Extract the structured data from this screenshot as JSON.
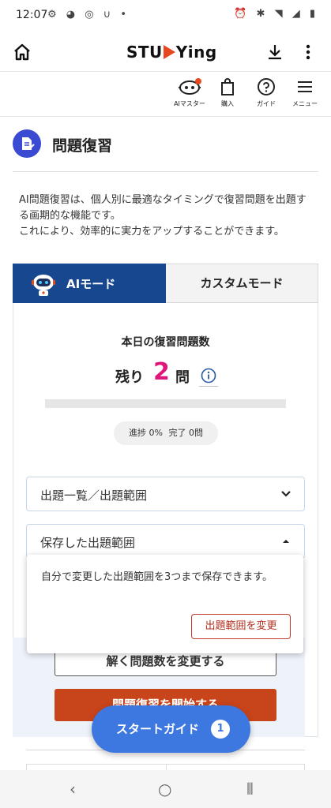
{
  "status_bar": {
    "time": "12:07",
    "left_icons": [
      "settings-icon",
      "photo-icon",
      "chrome-icon",
      "magnet-icon",
      "dot-icon"
    ],
    "right_icons": [
      "alarm-icon",
      "bluetooth-icon",
      "wifi-icon",
      "signal-icon",
      "battery-icon"
    ]
  },
  "header": {
    "logo_left": "STU",
    "logo_right": "Ying"
  },
  "toolbar": {
    "items": [
      {
        "label": "AIマスター",
        "icon": "robot-icon",
        "has_badge": true
      },
      {
        "label": "購入",
        "icon": "shopping-bag-icon"
      },
      {
        "label": "ガイド",
        "icon": "help-circle-icon"
      },
      {
        "label": "メニュー",
        "icon": "hamburger-icon"
      }
    ]
  },
  "page": {
    "title": "問題復習",
    "description": "AI問題復習は、個人別に最適なタイミングで復習問題を出題する画期的な機能です。\nこれにより、効率的に実力をアップすることができます。"
  },
  "tabs": {
    "ai": "AIモード",
    "custom": "カスタムモード",
    "active": "ai"
  },
  "review": {
    "today_label": "本日の復習問題数",
    "remaining_prefix": "残り",
    "remaining_count": "2",
    "remaining_suffix": "問",
    "progress_percent": 0,
    "progress_label": "進捗 0%",
    "completed_label": "完了 0問"
  },
  "accordions": {
    "question_list": "出題一覧／出題範囲",
    "saved_range": "保存した出題範囲"
  },
  "popover": {
    "text": "自分で変更した出題範囲を3つまで保存できます。",
    "button": "出題範囲を変更"
  },
  "actions": {
    "change_count": "解く問題数を変更する",
    "start_review": "問題復習を開始する"
  },
  "fab": {
    "label": "スタートガイド",
    "count": "1"
  },
  "colors": {
    "brand_blue": "#16478f",
    "accent_red": "#c8441b",
    "count_pink": "#e0177b",
    "fab_blue": "#3d78e0",
    "logo_orange": "#e8481e"
  }
}
